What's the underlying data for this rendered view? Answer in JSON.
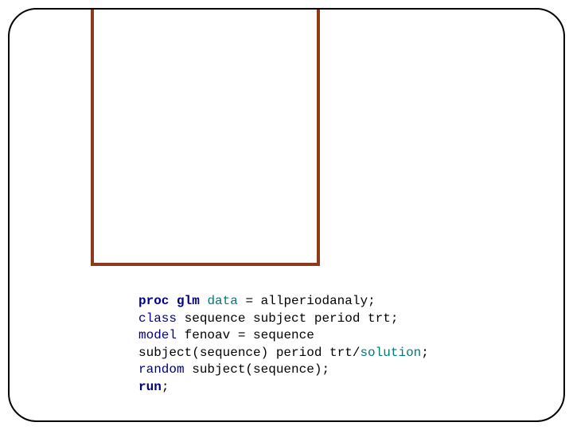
{
  "code": {
    "proc": "proc",
    "glm": "glm",
    "data_kw": "data",
    "eq1": " = allperiodanaly;",
    "class_kw": "class",
    "class_rest": " sequence subject period trt;",
    "model_kw": "model",
    "model_rest1": " fenoav = sequence",
    "model_rest2": "subject(sequence) period trt/",
    "solution": "solution",
    "semi1": ";",
    "random_kw": "random",
    "random_rest": " subject(sequence);",
    "run_kw": "run",
    "semi2": ";"
  }
}
